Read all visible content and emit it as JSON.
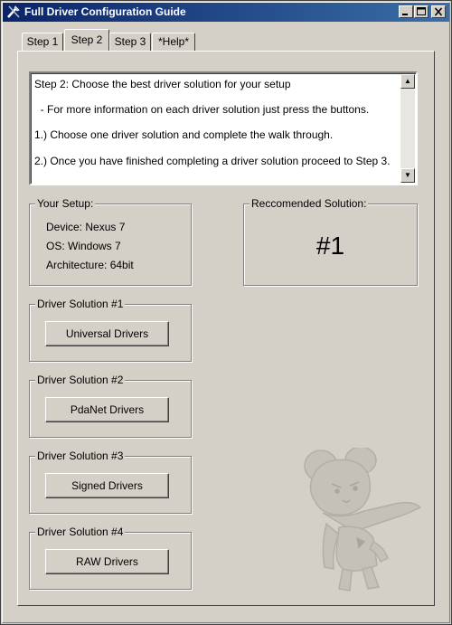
{
  "window": {
    "title": "Full Driver Configuration Guide",
    "title_bar_color": "#0a246a",
    "controls": [
      "minimize-icon",
      "maximize-icon",
      "close-icon"
    ]
  },
  "tabs": [
    {
      "label": "Step 1",
      "active": false
    },
    {
      "label": "Step 2",
      "active": true
    },
    {
      "label": "Step 3",
      "active": false
    },
    {
      "label": "*Help*",
      "active": false
    }
  ],
  "instructions": {
    "lines": [
      "Step 2:  Choose the best driver solution for your setup",
      "  - For more information on each driver solution just press the buttons.",
      "1.)  Choose one driver solution and complete the walk through.",
      "2.)  Once you have finished completing a driver solution proceed to Step 3."
    ]
  },
  "setup": {
    "heading": "Your Setup:",
    "device": "Device: Nexus 7",
    "os": "OS: Windows 7",
    "architecture": "Architecture: 64bit"
  },
  "recommended": {
    "heading": "Reccomended Solution:",
    "value": "#1"
  },
  "solutions": [
    {
      "heading": "Driver Solution #1",
      "button_label": "Universal Drivers"
    },
    {
      "heading": "Driver Solution #2",
      "button_label": "PdaNet Drivers"
    },
    {
      "heading": "Driver Solution #3",
      "button_label": "Signed Drivers"
    },
    {
      "heading": "Driver Solution #4",
      "button_label": "RAW Drivers"
    }
  ],
  "decor": {
    "mascot": "mouse-mascot-icon"
  }
}
